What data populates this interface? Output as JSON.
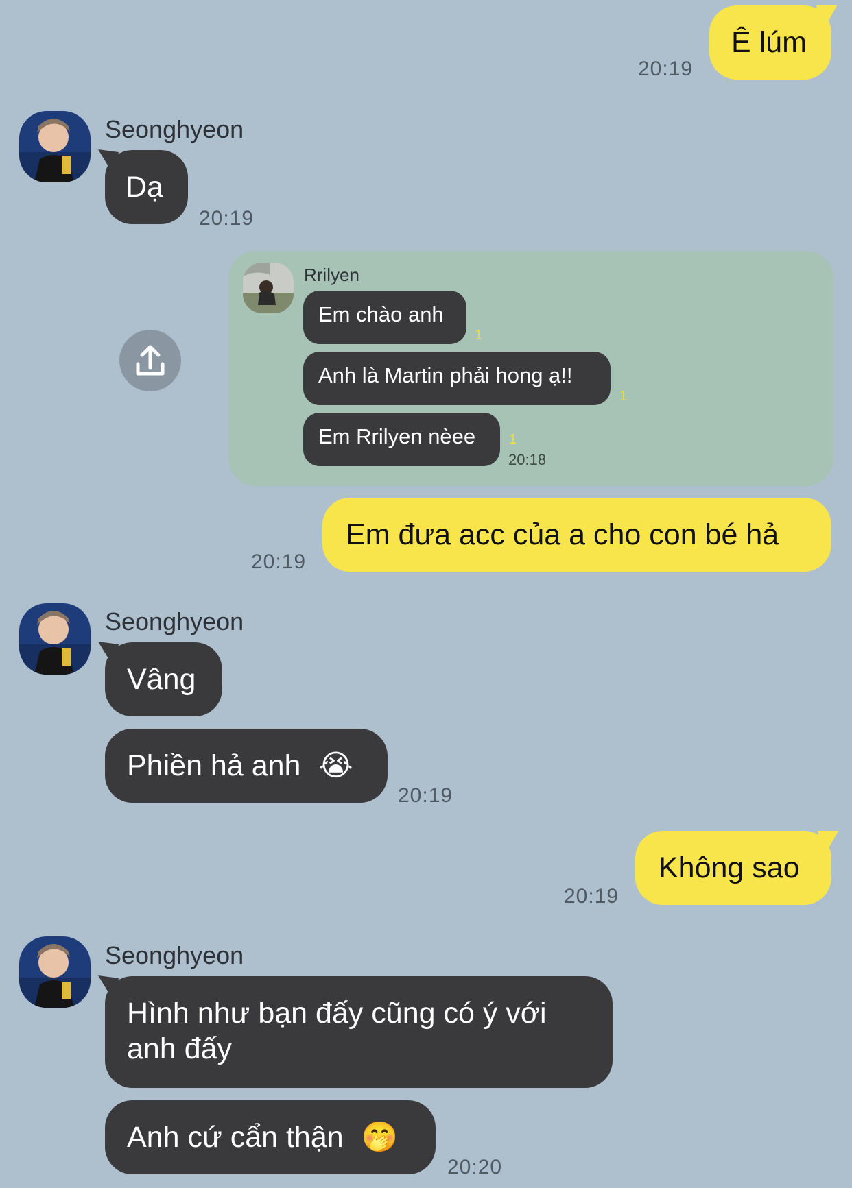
{
  "messages": {
    "m1": {
      "text": "Ê lúm",
      "time": "20:19"
    },
    "m2": {
      "sender": "Seonghyeon",
      "text": "Dạ",
      "time": "20:19"
    },
    "quote": {
      "sender": "Rrilyen",
      "lines": [
        "Em chào anh",
        "Anh là Martin phải hong ạ!!",
        "Em Rrilyen nèee"
      ],
      "unread": [
        "1",
        "1",
        "1"
      ],
      "time": "20:18"
    },
    "m3": {
      "text": "Em đưa acc của a cho con bé hả",
      "time": "20:19"
    },
    "m4": {
      "sender": "Seonghyeon",
      "lines": [
        "Vâng",
        "Phiền hả anh"
      ],
      "emoji": "😭",
      "time": "20:19"
    },
    "m5": {
      "text": "Không sao",
      "time": "20:19"
    },
    "m6": {
      "sender": "Seonghyeon",
      "line1a": "Hình như bạn đấy cũng có ý với",
      "line1b": "anh đấy",
      "line2": "Anh cứ cẩn thận",
      "emoji": "🤭",
      "time": "20:20"
    }
  },
  "colors": {
    "background": "#aebfce",
    "my_bubble": "#f8e54b",
    "their_bubble": "#3a3a3c",
    "quote_bg": "#a7c3b5"
  },
  "icons": {
    "share": "share-upload-icon"
  }
}
